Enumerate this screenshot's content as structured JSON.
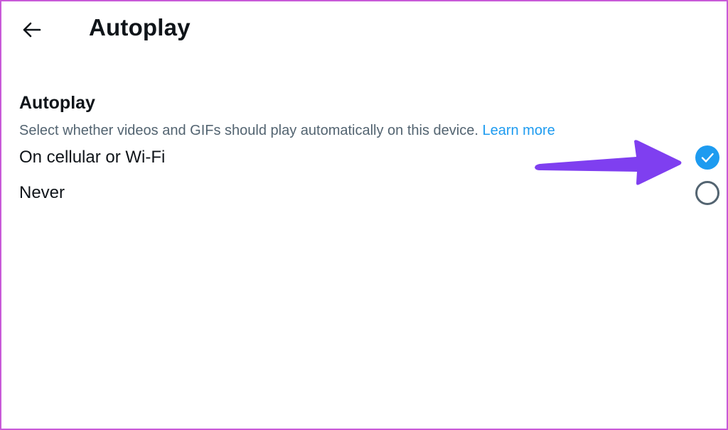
{
  "header": {
    "back_icon": "arrow-left-icon",
    "title": "Autoplay"
  },
  "section": {
    "title": "Autoplay",
    "description": "Select whether videos and GIFs should play automatically on this device.",
    "learn_more": "Learn more"
  },
  "options": [
    {
      "label": "On cellular or Wi-Fi",
      "selected": true
    },
    {
      "label": "Never",
      "selected": false
    }
  ],
  "annotation": {
    "icon": "arrow-annotation-icon",
    "color": "#7f3ff0"
  },
  "colors": {
    "accent": "#1d9bf0",
    "text": "#0f1419",
    "secondary_text": "#536471",
    "frame_border": "#c85ad8"
  }
}
